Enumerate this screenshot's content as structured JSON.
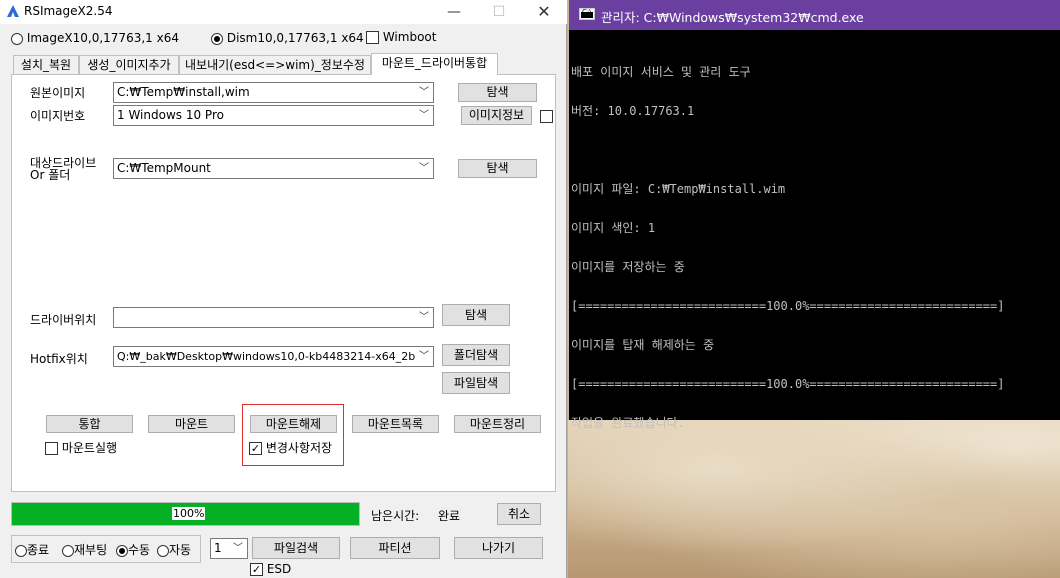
{
  "rsx": {
    "title": "RSImageX2.54",
    "controls": {
      "minimize": "—",
      "maximize": "☐",
      "close": "✕"
    },
    "modes": [
      {
        "label": "ImageX10,0,17763,1 x64",
        "selected": false
      },
      {
        "label": "Dism10,0,17763,1 x64",
        "selected": true
      }
    ],
    "wimboot": {
      "label": "Wimboot",
      "checked": false
    },
    "tabs": [
      {
        "label": "설치_복원",
        "active": false
      },
      {
        "label": "생성_이미지추가",
        "active": false
      },
      {
        "label": "내보내기(esd<=>wim)_정보수정",
        "active": false
      },
      {
        "label": "마운트_드라이버통합",
        "active": true
      }
    ],
    "source_image": {
      "label": "원본이미지",
      "value": "C:₩Temp₩install,wim",
      "browse": "탐색"
    },
    "image_index": {
      "label": "이미지번호",
      "value": "1  Windows 10 Pro",
      "info_button": "이미지정보"
    },
    "target": {
      "label_line1": "대상드라이브",
      "label_line2": "Or 폴더",
      "value": "C:₩TempMount",
      "browse": "탐색"
    },
    "driver": {
      "label": "드라이버위치",
      "value": "",
      "browse": "탐색"
    },
    "hotfix": {
      "label": "Hotfix위치",
      "value": "Q:₩_bak₩Desktop₩windows10,0-kb4483214-x64_2b",
      "folder_browse": "폴더탐색",
      "file_browse": "파일탐색"
    },
    "actions": {
      "integrate": "통합",
      "mount": "마운트",
      "unmount": "마운트해제",
      "mount_list": "마운트목록",
      "mount_cleanup": "마운트정리"
    },
    "mount_run": {
      "label": "마운트실행",
      "checked": false
    },
    "save_changes": {
      "label": "변경사항저장",
      "checked": true
    },
    "progress": {
      "percent": 100,
      "text": "100%"
    },
    "remaining": {
      "label": "남은시간:",
      "value": "완료"
    },
    "cancel": "취소",
    "finish_options": [
      {
        "label": "종료",
        "selected": false
      },
      {
        "label": "재부팅",
        "selected": false
      },
      {
        "label": "수동",
        "selected": true
      },
      {
        "label": "자동",
        "selected": false
      }
    ],
    "count_select": "1",
    "file_search": "파일검색",
    "partition": "파티션",
    "exit": "나가기",
    "esd": {
      "label": "ESD",
      "checked": true
    }
  },
  "cmd": {
    "icon_text": "C:\\",
    "title": "관리자: C:₩Windows₩system32₩cmd.exe",
    "lines": [
      "배포 이미지 서비스 및 관리 도구",
      "버전: 10.0.17763.1",
      "",
      "이미지 파일: C:₩Temp₩install.wim",
      "이미지 색인: 1",
      "이미지를 저장하는 중",
      "[==========================100.0%==========================]",
      "이미지를 탑재 해제하는 중",
      "[==========================100.0%==========================]",
      "작업을 완료했습니다."
    ]
  },
  "colors": {
    "cmd_titlebar": "#6b3fa0",
    "progress_fill": "#06b025",
    "highlight": "#d9302c"
  }
}
